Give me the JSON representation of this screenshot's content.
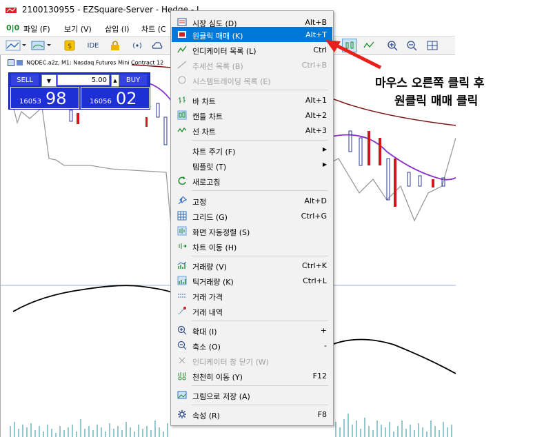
{
  "window": {
    "title": "2100130955 - EZSquare-Server - Hedge - I"
  },
  "menubar": {
    "items": [
      "파일 (F)",
      "보기 (V)",
      "삽입 (I)",
      "차트 (C"
    ]
  },
  "toolbar": {
    "ide_label": "IDE"
  },
  "chart": {
    "title": "NQDEC.a2z, M1:  Nasdaq Futures Mini Contract 12"
  },
  "trade_panel": {
    "sell_label": "SELL",
    "buy_label": "BUY",
    "lots": "5.00",
    "sell_price_small": "16053",
    "sell_price_big": "98",
    "buy_price_small": "16056",
    "buy_price_big": "02"
  },
  "context_menu": {
    "items": [
      {
        "label": "시장 심도 (D)",
        "shortcut": "Alt+B",
        "icon": "market-depth-icon"
      },
      {
        "label": "원클릭 매매 (K)",
        "shortcut": "Alt+T",
        "icon": "one-click-trading-icon",
        "highlighted": true
      },
      {
        "label": "인디케이터 목록 (L)",
        "shortcut": "Ctrl",
        "icon": "indicator-list-icon"
      },
      {
        "label": "추세선 목록 (B)",
        "shortcut": "Ctrl+B",
        "icon": "trendline-list-icon",
        "disabled": true
      },
      {
        "label": "시스템트레이딩 목록 (E)",
        "shortcut": "",
        "icon": "system-trading-icon",
        "disabled": true
      },
      {
        "label": "바 차트",
        "shortcut": "Alt+1",
        "icon": "bar-chart-icon"
      },
      {
        "label": "캔들 차트",
        "shortcut": "Alt+2",
        "icon": "candle-chart-icon"
      },
      {
        "label": "선 차트",
        "shortcut": "Alt+3",
        "icon": "line-chart-icon"
      },
      {
        "label": "차트 주기 (F)",
        "shortcut": "",
        "icon": "",
        "submenu": true
      },
      {
        "label": "템플릿 (T)",
        "shortcut": "",
        "icon": "",
        "submenu": true
      },
      {
        "label": "새로고침",
        "shortcut": "",
        "icon": "refresh-icon"
      },
      {
        "label": "고정",
        "shortcut": "Alt+D",
        "icon": "pin-icon"
      },
      {
        "label": "그리드 (G)",
        "shortcut": "Ctrl+G",
        "icon": "grid-icon"
      },
      {
        "label": "화면 자동정렬 (S)",
        "shortcut": "",
        "icon": "auto-scroll-icon"
      },
      {
        "label": "차트 이동 (H)",
        "shortcut": "",
        "icon": "chart-shift-icon"
      },
      {
        "label": "거래량 (V)",
        "shortcut": "Ctrl+K",
        "icon": "volume-icon"
      },
      {
        "label": "틱거래량 (K)",
        "shortcut": "Ctrl+L",
        "icon": "tick-volume-icon"
      },
      {
        "label": "거래 가격",
        "shortcut": "",
        "icon": "trade-price-icon"
      },
      {
        "label": "거래 내역",
        "shortcut": "",
        "icon": "trade-history-icon"
      },
      {
        "label": "확대 (I)",
        "shortcut": "+",
        "icon": "zoom-in-icon"
      },
      {
        "label": "축소 (O)",
        "shortcut": "-",
        "icon": "zoom-out-icon"
      },
      {
        "label": "인디케이터 창 닫기 (W)",
        "shortcut": "",
        "icon": "close-icon",
        "disabled": true
      },
      {
        "label": "천천히 이동 (Y)",
        "shortcut": "F12",
        "icon": "step-icon"
      },
      {
        "label": "그림으로 저장 (A)",
        "shortcut": "",
        "icon": "save-picture-icon"
      },
      {
        "label": "속성 (R)",
        "shortcut": "F8",
        "icon": "properties-icon"
      }
    ]
  },
  "annotation": {
    "line1": "마우스 오른쪽 클릭 후",
    "line2": "원클릭 매매 클릭",
    "arrow_color": "#e8201a"
  },
  "colors": {
    "highlight": "#0078d7",
    "trade_panel": "#1f2fd6"
  }
}
